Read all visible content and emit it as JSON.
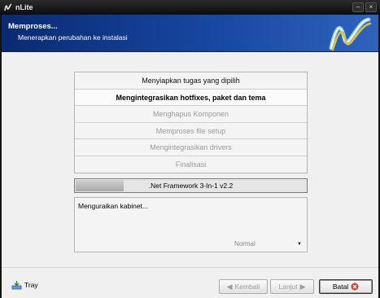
{
  "window": {
    "title": "nLite",
    "icons": {
      "minimize": "minimize-icon",
      "close": "close-icon"
    }
  },
  "header": {
    "title": "Memproses...",
    "subtitle": "Menerapkan perubahan ke instalasi"
  },
  "steps": [
    {
      "label": "Menyiapkan tugas yang dipilih",
      "state": "done"
    },
    {
      "label": "Mengintegrasikan hotfixes, paket dan tema",
      "state": "active"
    },
    {
      "label": "Menghapus Komponen",
      "state": "pending"
    },
    {
      "label": "Memproses file setup",
      "state": "pending"
    },
    {
      "label": "Mengintegrasikan drivers",
      "state": "pending"
    },
    {
      "label": "Finalisasi",
      "state": "pending"
    }
  ],
  "progress": {
    "label": ".Net Framework 3-In-1 v2.2",
    "fraction": 0.21
  },
  "log": {
    "text": "Menguraikan kabinet..."
  },
  "priority": {
    "selected": "Normal"
  },
  "footer": {
    "tray_label": "Tray",
    "back_label": "Kembali",
    "next_label": "Lanjut",
    "cancel_label": "Batal"
  },
  "colors": {
    "header_start": "#0a2a72",
    "header_end": "#2f63bd",
    "background": "#f0f0f0"
  }
}
